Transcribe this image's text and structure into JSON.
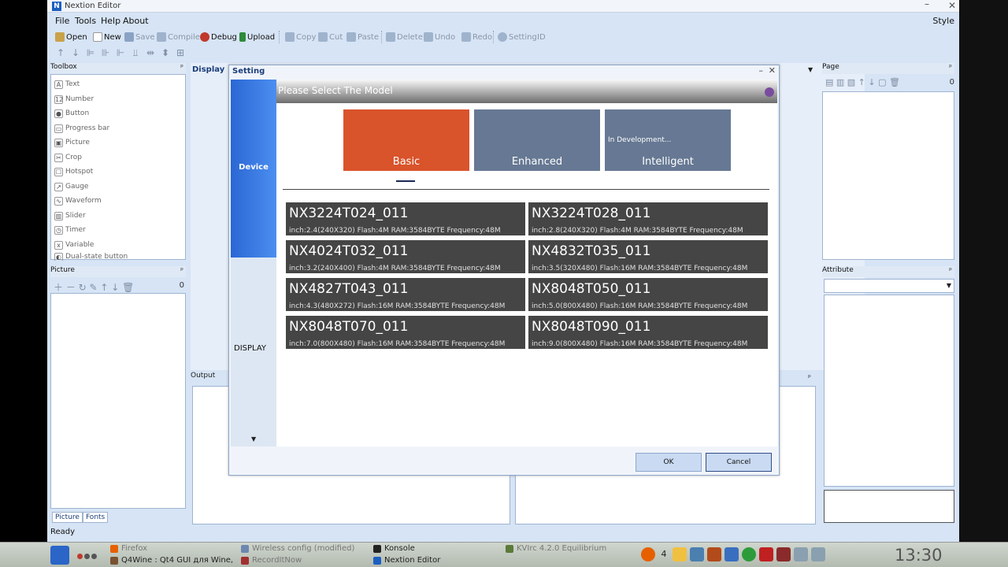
{
  "window": {
    "title": "Nextion Editor",
    "menu": [
      "File",
      "Tools",
      "Help",
      "About"
    ],
    "style_label": "Style"
  },
  "toolbar": [
    {
      "label": "Open",
      "color": "#c9a24a",
      "enabled": true
    },
    {
      "label": "New",
      "color": "#ffffff",
      "enabled": true
    },
    {
      "label": "Save",
      "color": "#8aa3c4",
      "enabled": false
    },
    {
      "label": "Compile",
      "color": "#9fb3cc",
      "enabled": false
    },
    {
      "label": "Debug",
      "color": "#c0392b",
      "enabled": true
    },
    {
      "label": "Upload",
      "color": "#2e8b3a",
      "enabled": true
    },
    {
      "label": "Copy",
      "color": "#9fb3cc",
      "enabled": false
    },
    {
      "label": "Cut",
      "color": "#9fb3cc",
      "enabled": false
    },
    {
      "label": "Paste",
      "color": "#9fb3cc",
      "enabled": false
    },
    {
      "label": "Delete",
      "color": "#9fb3cc",
      "enabled": false
    },
    {
      "label": "Undo",
      "color": "#9fb3cc",
      "enabled": false
    },
    {
      "label": "Redo",
      "color": "#9fb3cc",
      "enabled": false
    },
    {
      "label": "Setting",
      "color": "#9fb3cc",
      "enabled": false
    },
    {
      "label": "ID",
      "color": "",
      "enabled": false
    }
  ],
  "toolbox": {
    "title": "Toolbox",
    "items": [
      {
        "label": "Text",
        "icon": "A"
      },
      {
        "label": "Number",
        "icon": "12"
      },
      {
        "label": "Button",
        "icon": "●"
      },
      {
        "label": "Progress bar",
        "icon": "▭"
      },
      {
        "label": "Picture",
        "icon": "▣"
      },
      {
        "label": "Crop",
        "icon": "✂"
      },
      {
        "label": "Hotspot",
        "icon": "☐"
      },
      {
        "label": "Gauge",
        "icon": "↗"
      },
      {
        "label": "Waveform",
        "icon": "∿"
      },
      {
        "label": "Slider",
        "icon": "▥"
      },
      {
        "label": "Timer",
        "icon": "◷"
      },
      {
        "label": "Variable",
        "icon": "x"
      },
      {
        "label": "Dual-state button",
        "icon": "◐"
      }
    ]
  },
  "picture_panel": {
    "title": "Picture",
    "count": "0",
    "tabs": [
      "Picture",
      "Fonts"
    ]
  },
  "display": {
    "tab_label": "Display"
  },
  "output": {
    "title": "Output"
  },
  "page_panel": {
    "title": "Page",
    "count": "0"
  },
  "attribute_panel": {
    "title": "Attribute"
  },
  "status": {
    "text": "Ready"
  },
  "dialog": {
    "title": "Setting",
    "side_items": {
      "device": "Device",
      "display": "DISPLAY"
    },
    "header": "Please Select The Model",
    "categories": [
      {
        "label": "Basic",
        "note": "",
        "color": "#d9532b"
      },
      {
        "label": "Enhanced",
        "note": "",
        "color": "#667893"
      },
      {
        "label": "Intelligent",
        "note": "In Development...",
        "color": "#667893"
      }
    ],
    "models": [
      {
        "name": "NX3224T024_011",
        "spec": "inch:2.4(240X320)  Flash:4M  RAM:3584BYTE  Frequency:48M"
      },
      {
        "name": "NX3224T028_011",
        "spec": "inch:2.8(240X320)  Flash:4M  RAM:3584BYTE  Frequency:48M"
      },
      {
        "name": "NX4024T032_011",
        "spec": "inch:3.2(240X400)  Flash:4M  RAM:3584BYTE  Frequency:48M"
      },
      {
        "name": "NX4832T035_011",
        "spec": "inch:3.5(320X480)  Flash:16M  RAM:3584BYTE  Frequency:48M"
      },
      {
        "name": "NX4827T043_011",
        "spec": "inch:4.3(480X272)  Flash:16M  RAM:3584BYTE  Frequency:48M"
      },
      {
        "name": "NX8048T050_011",
        "spec": "inch:5.0(800X480)  Flash:16M  RAM:3584BYTE  Frequency:48M"
      },
      {
        "name": "NX8048T070_011",
        "spec": "inch:7.0(800X480)  Flash:16M  RAM:3584BYTE  Frequency:48M"
      },
      {
        "name": "NX8048T090_011",
        "spec": "inch:9.0(800X480)  Flash:16M  RAM:3584BYTE  Frequency:48M"
      }
    ],
    "ok_label": "OK",
    "cancel_label": "Cancel"
  },
  "taskbar": {
    "tasks": [
      {
        "label": "Firefox",
        "dim": true,
        "color": "#e66000"
      },
      {
        "label": "Q4Wine : Qt4 GUI для Wine,",
        "dim": false,
        "color": "#7a5230"
      },
      {
        "label": "Wireless config (modified)",
        "dim": true,
        "color": "#6d87b0"
      },
      {
        "label": "RecordItNow",
        "dim": true,
        "color": "#a03030"
      },
      {
        "label": "Konsole",
        "dim": false,
        "color": "#222222"
      },
      {
        "label": "Nextion Editor",
        "dim": false,
        "color": "#1d5fbf"
      },
      {
        "label": "KVIrc 4.2.0 Equilibrium",
        "dim": true,
        "color": "#5a7a3a"
      }
    ],
    "workspace": "4",
    "clock": "13:30"
  }
}
